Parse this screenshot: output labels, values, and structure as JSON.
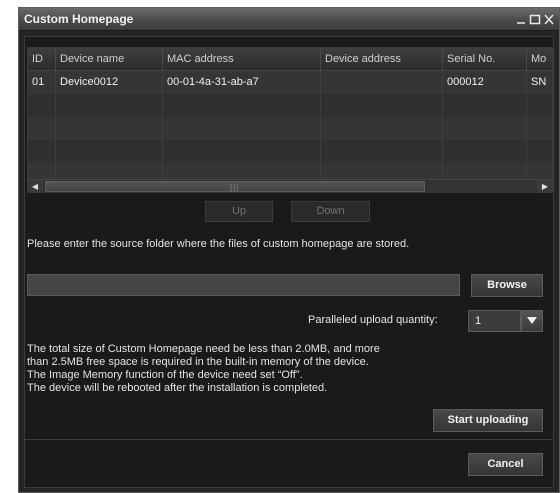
{
  "window": {
    "title": "Custom Homepage"
  },
  "table": {
    "columns": [
      "ID",
      "Device name",
      "MAC address",
      "Device address",
      "Serial No.",
      "Mo"
    ],
    "rows": [
      [
        "01",
        "Device0012",
        "00-01-4a-31-ab-a7",
        "",
        "000012",
        "SN"
      ]
    ]
  },
  "buttons": {
    "up": "Up",
    "down": "Down",
    "browse": "Browse",
    "start": "Start uploading",
    "cancel": "Cancel"
  },
  "source_prompt": "Please enter the source folder where the files of custom homepage are stored.",
  "source_folder": {
    "value": ""
  },
  "upload": {
    "label": "Paralleled upload quantity:",
    "value": "1"
  },
  "notes": [
    "The total size of Custom Homepage need be less than 2.0MB, and more",
    "than 2.5MB free space is required in the built-in memory of the device.",
    "The Image Memory function of the device need set “Off”.",
    "The device will be rebooted after the installation is completed."
  ]
}
